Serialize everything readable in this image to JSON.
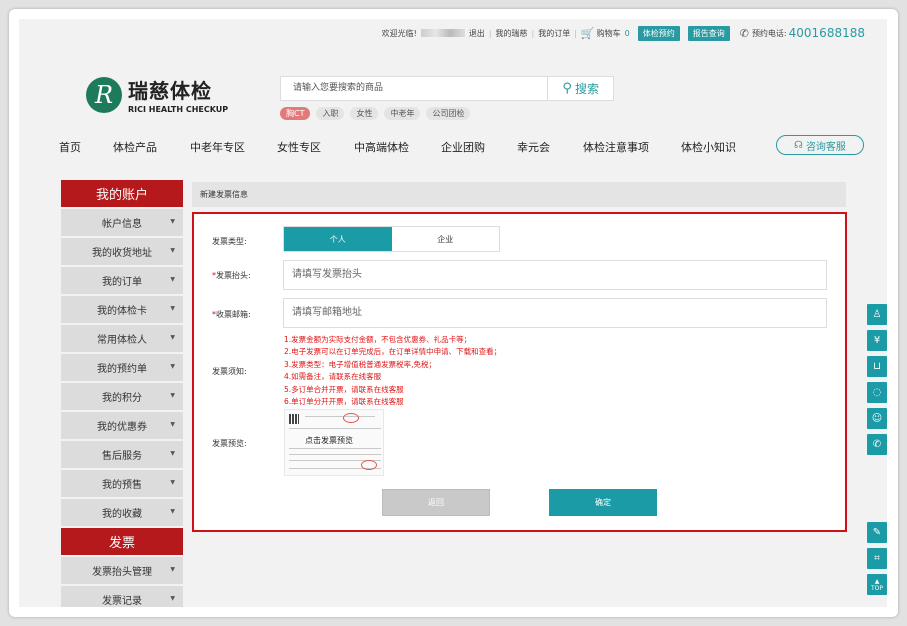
{
  "topbar": {
    "welcome": "欢迎光临!",
    "logout": "退出",
    "my_ruici": "我的瑞慈",
    "my_orders": "我的订单",
    "cart_label": "购物车",
    "cart_count": "0",
    "book_btn": "体检预约",
    "report_btn": "报告查询",
    "phone_label": "预约电话:",
    "phone_number": "4001688188"
  },
  "logo": {
    "mark": "R",
    "cn": "瑞慈体检",
    "en": "RICI HEALTH CHECKUP"
  },
  "search": {
    "placeholder": "请输入您要搜索的商品",
    "button": "搜索",
    "tags": [
      "胸CT",
      "入职",
      "女性",
      "中老年",
      "公司团检"
    ]
  },
  "nav": {
    "items": [
      "首页",
      "体检产品",
      "中老年专区",
      "女性专区",
      "中高端体检",
      "企业团购",
      "幸元会",
      "体检注意事项",
      "体检小知识"
    ],
    "consult": "咨询客服"
  },
  "sidebar": {
    "account_title": "我的账户",
    "account_items": [
      "帐户信息",
      "我的收货地址",
      "我的订单",
      "我的体检卡",
      "常用体检人",
      "我的预约单",
      "我的积分",
      "我的优惠券",
      "售后服务",
      "我的预售",
      "我的收藏"
    ],
    "invoice_title": "发票",
    "invoice_items": [
      "发票抬头管理",
      "发票记录"
    ]
  },
  "content": {
    "breadcrumb": "新建发票信息",
    "type_label": "发票类型:",
    "type_options": [
      "个人",
      "企业"
    ],
    "selected_type": "个人",
    "title_label": "发票抬头:",
    "title_placeholder": "请填写发票抬头",
    "email_label": "收票邮箱:",
    "email_placeholder": "请填写邮箱地址",
    "notes_label": "发票须知:",
    "notes": [
      "1.发票金额为实际支付金额，不包含优惠券、礼品卡等；",
      "2.电子发票可以在订单完成后，在订单详情中申请、下载和查看；",
      "3.发票类型：电子增值税普通发票税率,免税；",
      "4.如需备注，请联系在线客服",
      "5.多订单合并开票，请联系在线客服",
      "6.单订单分开开票，请联系在线客服"
    ],
    "required_mark": "*",
    "preview_label": "发票预览:",
    "preview_text": "点击发票预览",
    "back_btn": "返回",
    "ok_btn": "确定"
  },
  "float_bar": {
    "icons": [
      "user-icon",
      "yen-icon",
      "cart-icon",
      "chat-icon",
      "qq-icon",
      "phone-icon",
      "edit-icon",
      "scan-icon",
      "top-icon"
    ],
    "top_label": "TOP"
  },
  "colors": {
    "accent": "#1b9ba5",
    "brand_red": "#b5191c",
    "panel_border": "#d0111a"
  }
}
